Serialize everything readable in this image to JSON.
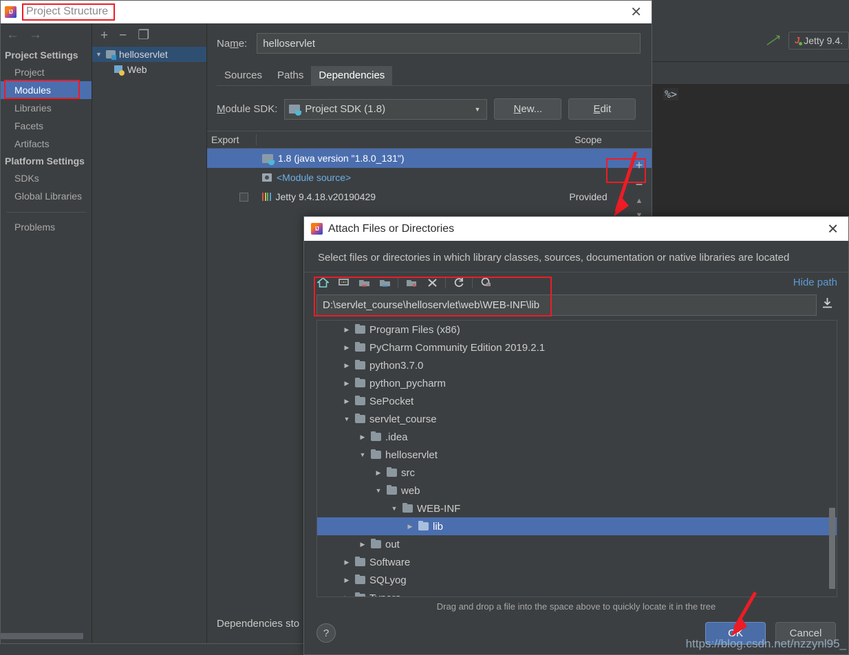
{
  "ide": {
    "hammer_icon": "build-hammer-icon",
    "run_config_label": "Jetty 9.4.",
    "editor_code_fragment": "%>"
  },
  "project_structure": {
    "title": "Project Structure",
    "close_label": "✕",
    "nav": {
      "back_label": "←",
      "forward_label": "→",
      "groups": [
        {
          "label": "Project Settings",
          "items": [
            {
              "label": "Project",
              "selected": false
            },
            {
              "label": "Modules",
              "selected": true
            },
            {
              "label": "Libraries",
              "selected": false
            },
            {
              "label": "Facets",
              "selected": false
            },
            {
              "label": "Artifacts",
              "selected": false
            }
          ]
        },
        {
          "label": "Platform Settings",
          "items": [
            {
              "label": "SDKs",
              "selected": false
            },
            {
              "label": "Global Libraries",
              "selected": false
            }
          ]
        }
      ],
      "problems_label": "Problems"
    },
    "modules": {
      "toolbar": {
        "add": "+",
        "remove": "−",
        "copy": "❐"
      },
      "tree": [
        {
          "label": "helloservlet",
          "selected": true,
          "expanded": true,
          "icon": "module-folder-icon"
        },
        {
          "label": "Web",
          "selected": false,
          "icon": "web-facet-icon"
        }
      ]
    },
    "name_label": "Na<u>m</u>e:",
    "name_value": "helloservlet",
    "tabs": [
      {
        "label": "Sources",
        "active": false
      },
      {
        "label": "Paths",
        "active": false
      },
      {
        "label": "Dependencies",
        "active": true
      }
    ],
    "sdk_label": "<u>M</u>odule SDK:",
    "sdk_value": "Project SDK (1.8)",
    "new_button": "<u>N</u>ew...",
    "edit_button": "<u>E</u>dit",
    "dep_columns": {
      "export": "Export",
      "name": "",
      "scope": "Scope"
    },
    "dep_rows": [
      {
        "export": "",
        "name": "1.8 (java version \"1.8.0_131\")",
        "scope": "",
        "icon": "jdk-icon",
        "selected": true
      },
      {
        "export": "",
        "name": "<Module source>",
        "scope": "",
        "icon": "module-source-icon",
        "selected": false,
        "link": true
      },
      {
        "export": "checkbox",
        "name": "Jetty 9.4.18.v20190429",
        "scope": "Provided",
        "icon": "library-icon",
        "selected": false
      }
    ],
    "side_buttons": [
      "+",
      "−",
      "▲",
      "▼"
    ],
    "bottom_label": "Dependencies sto"
  },
  "attach_dialog": {
    "title": "Attach Files or Directories",
    "close_label": "✕",
    "description": "Select files or directories in which library classes, sources, documentation or native libraries are located",
    "toolbar_icons": [
      "home-icon",
      "desktop-icon",
      "collapse-folder-icon",
      "expand-folder-icon",
      "new-folder-icon",
      "delete-icon",
      "refresh-icon",
      "show-hidden-icon"
    ],
    "hide_path_label": "Hide path",
    "path_value": "D:\\servlet_course\\helloservlet\\web\\WEB-INF\\lib",
    "download_icon": "⬇",
    "tree": [
      {
        "label": "Program Files (x86)",
        "indent": 1,
        "state": "collapsed",
        "selected": false
      },
      {
        "label": "PyCharm Community Edition 2019.2.1",
        "indent": 1,
        "state": "collapsed",
        "selected": false
      },
      {
        "label": "python3.7.0",
        "indent": 1,
        "state": "collapsed",
        "selected": false
      },
      {
        "label": "python_pycharm",
        "indent": 1,
        "state": "collapsed",
        "selected": false
      },
      {
        "label": "SePocket",
        "indent": 1,
        "state": "collapsed",
        "selected": false
      },
      {
        "label": "servlet_course",
        "indent": 1,
        "state": "expanded",
        "selected": false
      },
      {
        "label": ".idea",
        "indent": 2,
        "state": "collapsed",
        "selected": false
      },
      {
        "label": "helloservlet",
        "indent": 2,
        "state": "expanded",
        "selected": false
      },
      {
        "label": "src",
        "indent": 3,
        "state": "collapsed",
        "selected": false
      },
      {
        "label": "web",
        "indent": 3,
        "state": "expanded",
        "selected": false
      },
      {
        "label": "WEB-INF",
        "indent": 4,
        "state": "expanded",
        "selected": false
      },
      {
        "label": "lib",
        "indent": 5,
        "state": "collapsed",
        "selected": true
      },
      {
        "label": "out",
        "indent": 2,
        "state": "collapsed",
        "selected": false
      },
      {
        "label": "Software",
        "indent": 1,
        "state": "collapsed",
        "selected": false
      },
      {
        "label": "SQLyog",
        "indent": 1,
        "state": "collapsed",
        "selected": false
      },
      {
        "label": "Typora",
        "indent": 1,
        "state": "collapsed",
        "selected": false
      }
    ],
    "hint": "Drag and drop a file into the space above to quickly locate it in the tree",
    "help_label": "?",
    "ok_label": "OK",
    "cancel_label": "Cancel"
  },
  "watermark": "https://blog.csdn.net/nzzynl95_",
  "colors": {
    "accent_selection": "#4b6eaf",
    "annotation_red": "#ee1c25",
    "link_blue": "#5b9bd5",
    "panel_bg": "#3c3f41",
    "editor_bg": "#2b2b2b"
  }
}
